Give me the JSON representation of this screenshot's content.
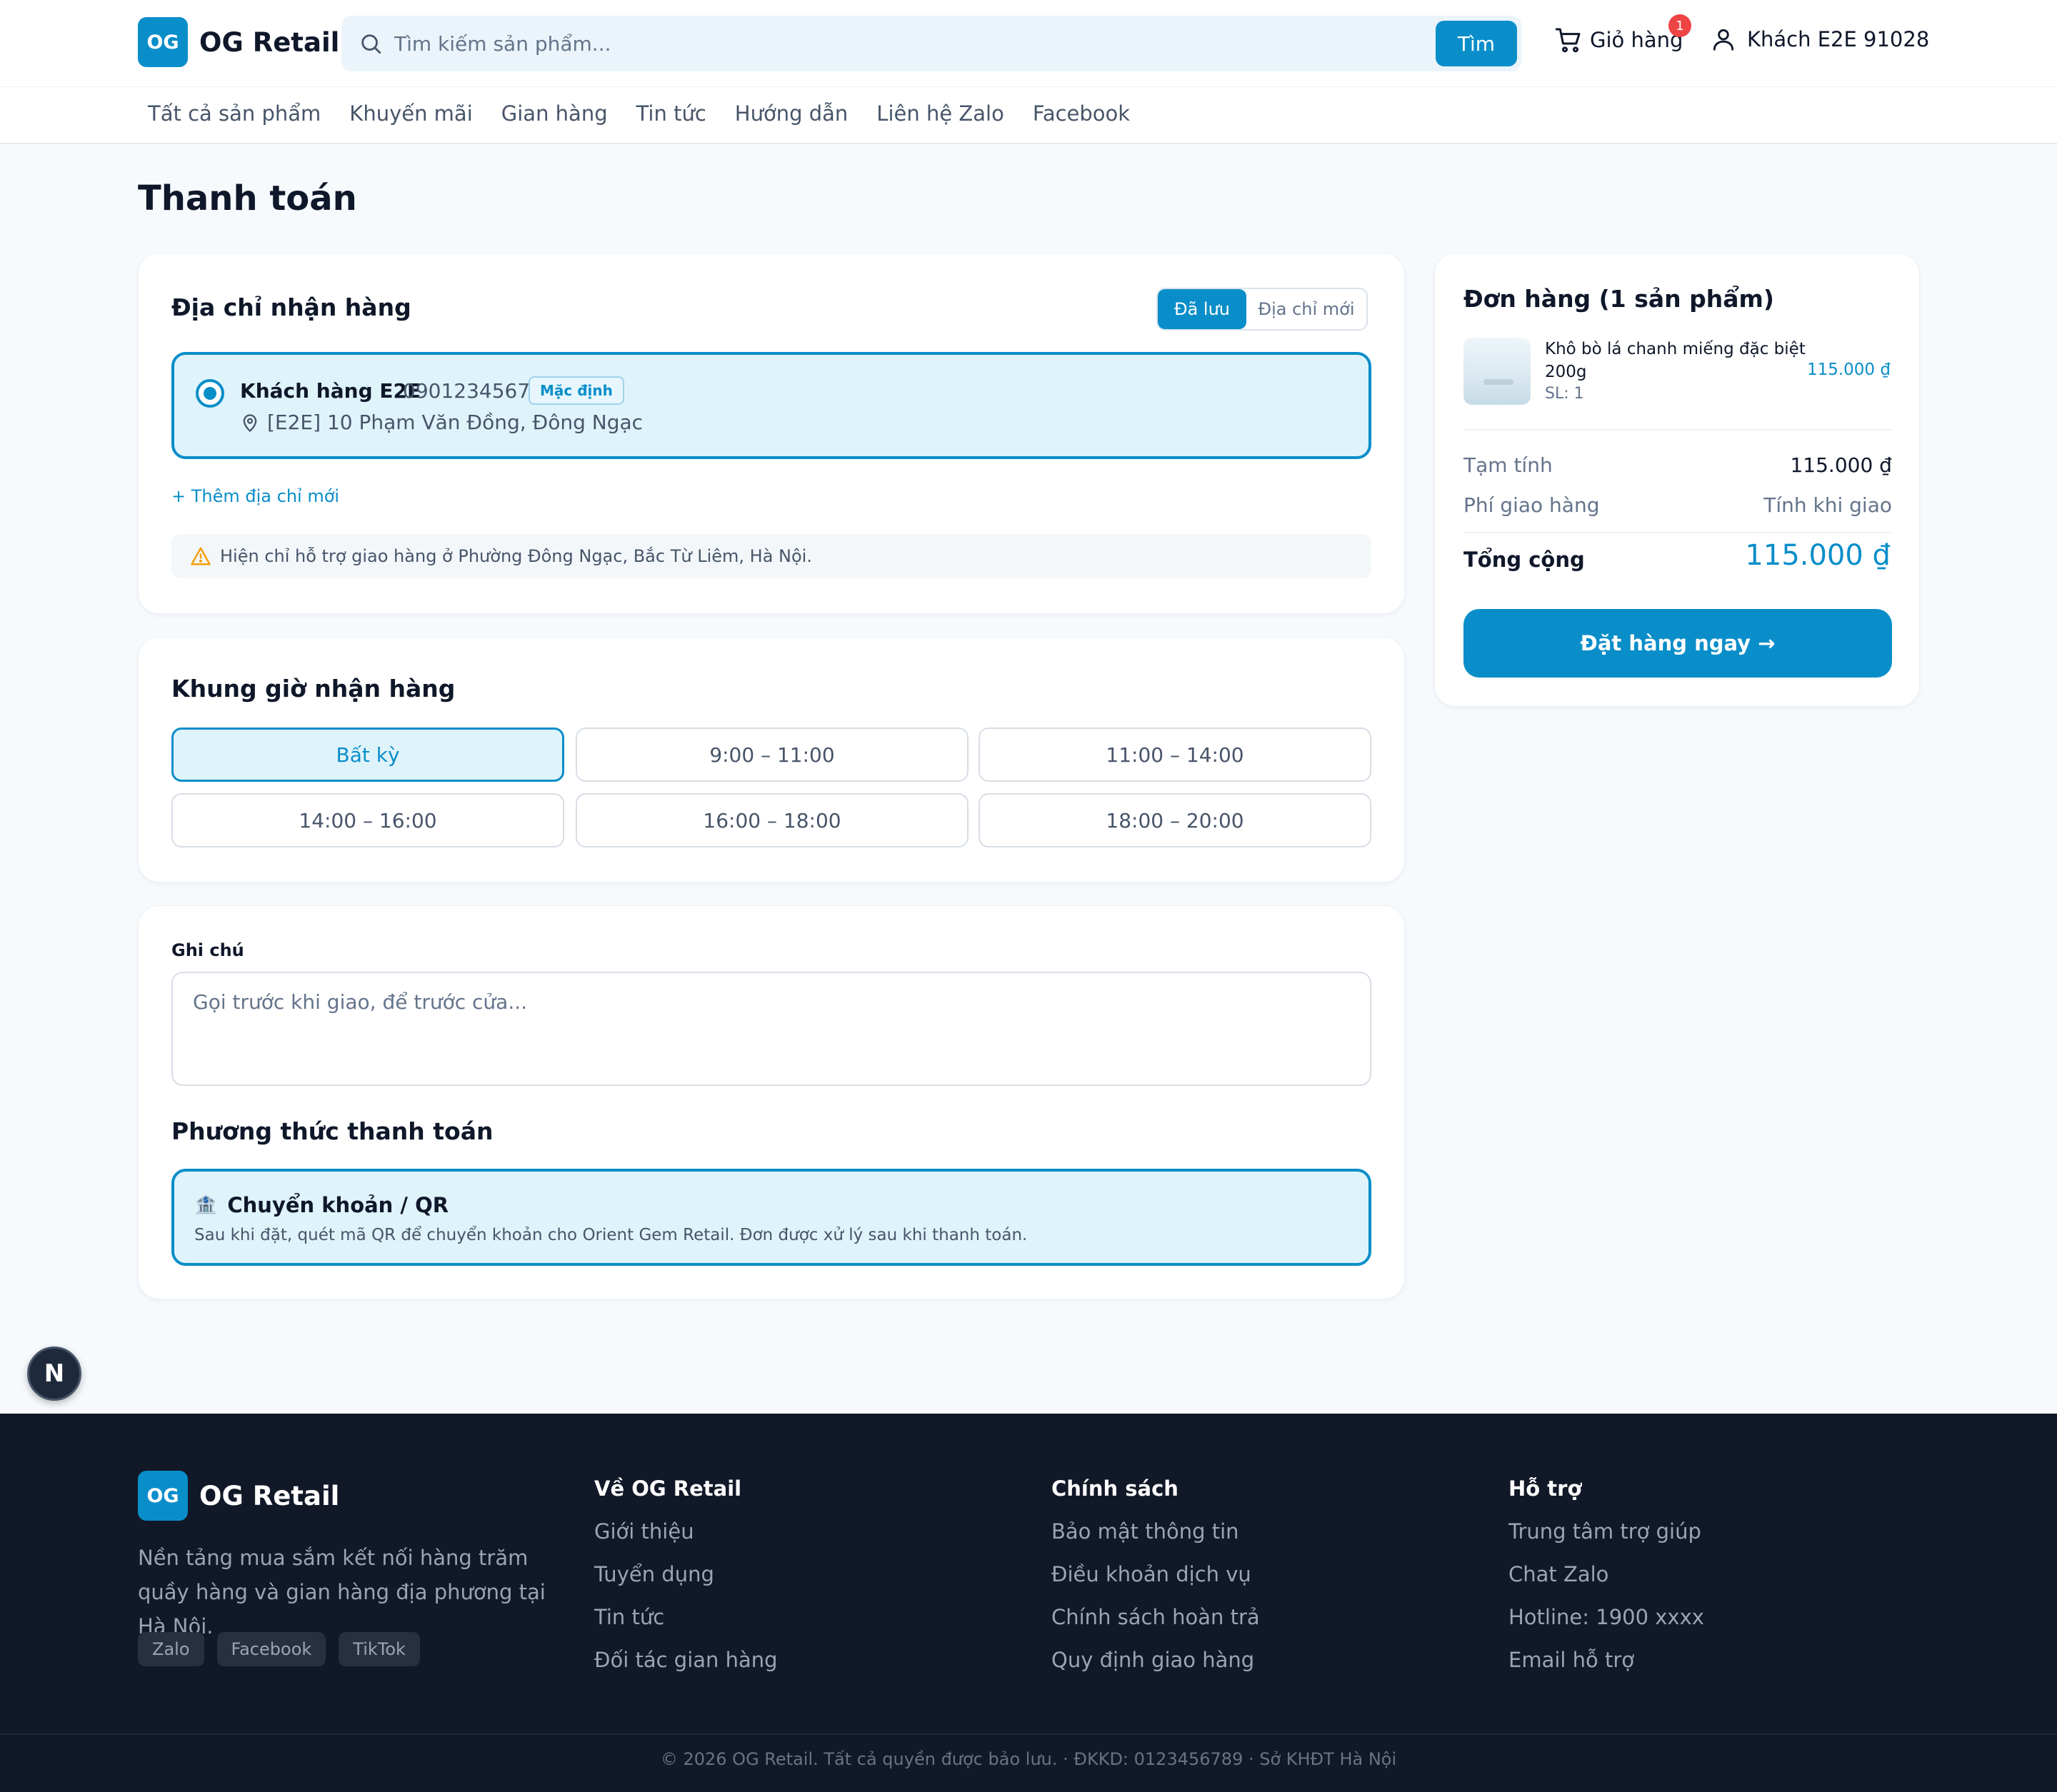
{
  "header": {
    "logo_badge": "OG",
    "logo_text": "OG Retail",
    "search_placeholder": "Tìm kiếm sản phẩm...",
    "search_button": "Tìm",
    "cart_label": "Giỏ hàng",
    "cart_count": "1",
    "account_label": "Khách E2E 91028"
  },
  "nav": {
    "items": [
      "Tất cả sản phẩm",
      "Khuyến mãi",
      "Gian hàng",
      "Tin tức",
      "Hướng dẫn",
      "Liên hệ Zalo",
      "Facebook"
    ]
  },
  "page_title": "Thanh toán",
  "address": {
    "title": "Địa chỉ nhận hàng",
    "toggle_saved": "Đã lưu",
    "toggle_new": "Địa chỉ mới",
    "selected": {
      "name": "Khách hàng E2E",
      "phone": "0901234567",
      "badge": "Mặc định",
      "line": "[E2E] 10 Phạm Văn Đồng, Đông Ngạc"
    },
    "add_new": "+ Thêm địa chỉ mới",
    "notice": "Hiện chỉ hỗ trợ giao hàng ở Phường Đông Ngạc, Bắc Từ Liêm, Hà Nội."
  },
  "timeslot": {
    "title": "Khung giờ nhận hàng",
    "slots": [
      "Bất kỳ",
      "9:00 – 11:00",
      "11:00 – 14:00",
      "14:00 – 16:00",
      "16:00 – 18:00",
      "18:00 – 20:00"
    ],
    "selected": "Bất kỳ"
  },
  "note": {
    "label": "Ghi chú",
    "placeholder": "Gọi trước khi giao, để trước cửa..."
  },
  "payment": {
    "title": "Phương thức thanh toán",
    "method_icon": "bank-icon",
    "method_name": "Chuyển khoản / QR",
    "method_desc": "Sau khi đặt, quét mã QR để chuyển khoản cho Orient Gem Retail. Đơn được xử lý sau khi thanh toán."
  },
  "order": {
    "title": "Đơn hàng (1 sản phẩm)",
    "item": {
      "name": "Khô bò lá chanh miếng đặc biệt 200g",
      "qty": "SL: 1",
      "price": "115.000 ₫"
    },
    "subtotal_label": "Tạm tính",
    "subtotal_value": "115.000 ₫",
    "shipping_label": "Phí giao hàng",
    "shipping_value": "Tính khi giao",
    "total_label": "Tổng cộng",
    "total_value": "115.000 ₫",
    "order_button": "Đặt hàng ngay →"
  },
  "fab_label": "N",
  "footer": {
    "logo_badge": "OG",
    "logo_text": "OG Retail",
    "description": "Nền tảng mua sắm kết nối hàng trăm quầy hàng và gian hàng địa phương tại Hà Nội.",
    "social": [
      "Zalo",
      "Facebook",
      "TikTok"
    ],
    "columns": [
      {
        "title": "Về OG Retail",
        "links": [
          "Giới thiệu",
          "Tuyển dụng",
          "Tin tức",
          "Đối tác gian hàng"
        ]
      },
      {
        "title": "Chính sách",
        "links": [
          "Bảo mật thông tin",
          "Điều khoản dịch vụ",
          "Chính sách hoàn trả",
          "Quy định giao hàng"
        ]
      },
      {
        "title": "Hỗ trợ",
        "links": [
          "Trung tâm trợ giúp",
          "Chat Zalo",
          "Hotline: 1900 xxxx",
          "Email hỗ trợ"
        ]
      }
    ],
    "copyright": "© 2026 OG Retail. Tất cả quyền được bảo lưu. · ĐKKD: 0123456789 · Sở KHĐT Hà Nội"
  },
  "colors": {
    "primary": "#0a8ec9",
    "selected_bg": "#dff3fb",
    "footer_bg": "#111827",
    "badge_red": "#ef4444"
  }
}
